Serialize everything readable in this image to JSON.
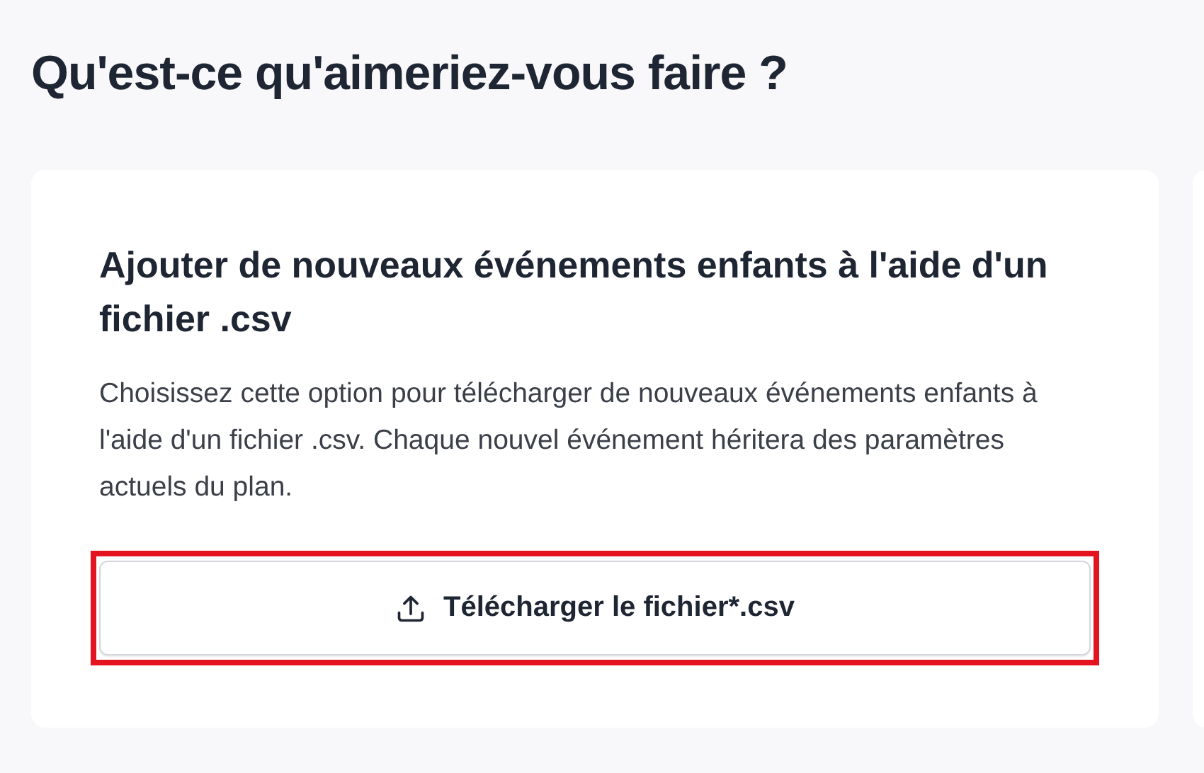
{
  "heading": "Qu'est-ce qu'aimeriez-vous faire ?",
  "card": {
    "title": "Ajouter de nouveaux événements enfants à l'aide d'un fichier .csv",
    "description": "Choisissez cette option pour télécharger de nouveaux événements enfants à l'aide d'un fichier .csv. Chaque nouvel événement héritera des paramètres actuels du plan.",
    "button": {
      "label": "Télécharger le fichier*.csv",
      "highlighted": true
    }
  }
}
